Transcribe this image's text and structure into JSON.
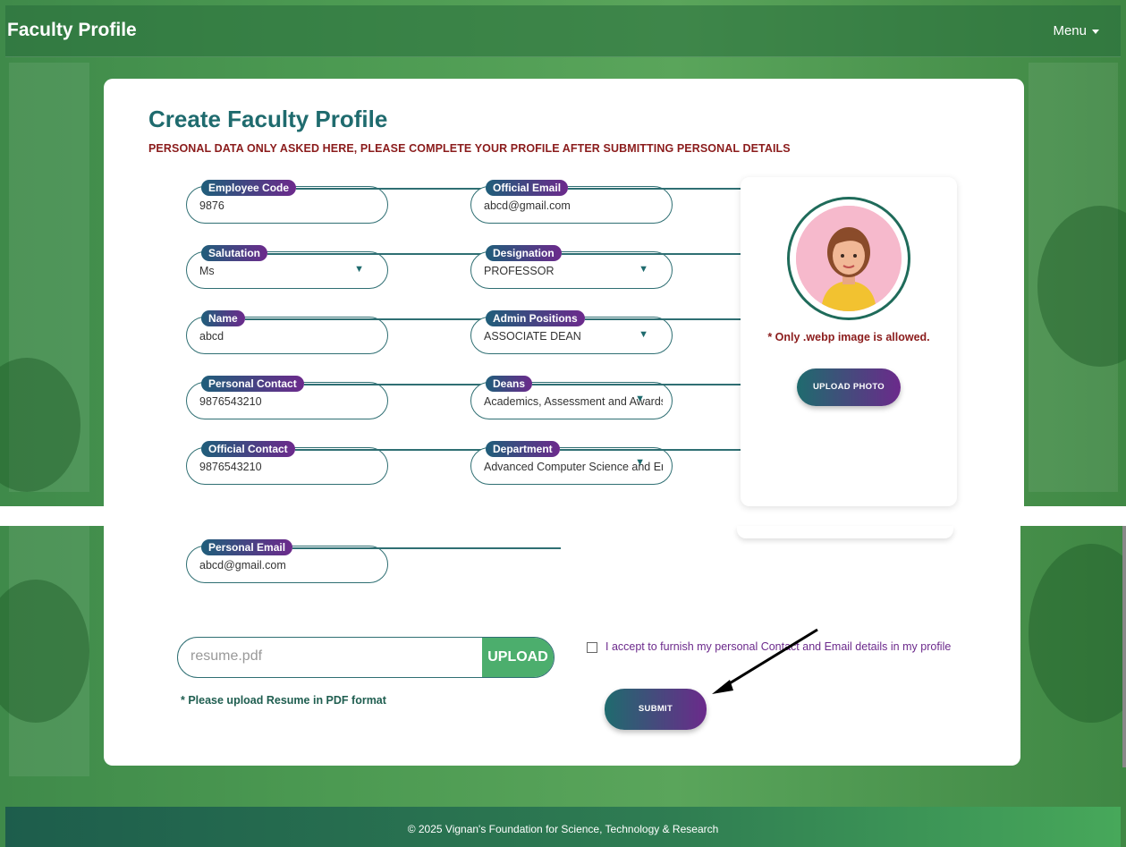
{
  "navbar": {
    "brand": "Faculty Profile",
    "menu_label": "Menu"
  },
  "form": {
    "title": "Create Faculty Profile",
    "subtitle": "PERSONAL DATA ONLY ASKED HERE, PLEASE COMPLETE YOUR PROFILE AFTER SUBMITTING PERSONAL DETAILS",
    "fields": {
      "employee_code": {
        "label": "Employee Code",
        "value": "9876"
      },
      "official_email": {
        "label": "Official Email",
        "value": "abcd@gmail.com"
      },
      "salutation": {
        "label": "Salutation",
        "value": "Ms"
      },
      "designation": {
        "label": "Designation",
        "value": "PROFESSOR"
      },
      "name": {
        "label": "Name",
        "value": "abcd"
      },
      "admin_positions": {
        "label": "Admin Positions",
        "value": "ASSOCIATE DEAN"
      },
      "personal_contact": {
        "label": "Personal Contact",
        "value": "9876543210"
      },
      "deans": {
        "label": "Deans",
        "value": "Academics, Assessment and Awards"
      },
      "official_contact": {
        "label": "Official Contact",
        "value": "9876543210"
      },
      "department": {
        "label": "Department",
        "value": "Advanced Computer Science and Engineering"
      },
      "personal_email": {
        "label": "Personal Email",
        "value": "abcd@gmail.com"
      }
    },
    "photo": {
      "note": "* Only .webp image is allowed.",
      "upload_label": "UPLOAD PHOTO"
    },
    "resume": {
      "filename": "resume.pdf",
      "upload_label": "UPLOAD",
      "note": "* Please upload Resume in PDF format"
    },
    "consent_label": "I accept to furnish my personal Contact and Email details in my profile",
    "submit_label": "SUBMIT"
  },
  "footer": {
    "text": "© 2025 Vignan's Foundation for Science, Technology & Research"
  },
  "colors": {
    "accent": "#1f6b6e",
    "brand_purple": "#6b2a8b",
    "upload_green": "#4cae6d",
    "warning": "#8b1c1c"
  }
}
